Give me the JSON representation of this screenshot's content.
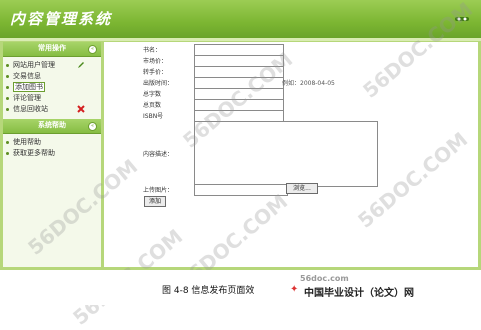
{
  "app": {
    "title": "内容管理系统"
  },
  "sidebar": {
    "panels": [
      {
        "title": "常用操作",
        "items": [
          {
            "label": "网站用户管理"
          },
          {
            "label": "交易信息"
          },
          {
            "label": "添加图书"
          },
          {
            "label": "评论管理"
          },
          {
            "label": "信息回收站"
          }
        ]
      },
      {
        "title": "系统帮助",
        "items": [
          {
            "label": "使用帮助"
          },
          {
            "label": "获取更多帮助"
          }
        ]
      }
    ]
  },
  "form": {
    "fields": {
      "book_name": {
        "label": "书名：",
        "value": ""
      },
      "market_price": {
        "label": "市场价：",
        "value": ""
      },
      "sale_price": {
        "label": "转手价：",
        "value": ""
      },
      "publish_date": {
        "label": "出版时间：",
        "value": "",
        "hint": "例如：2008-04-05"
      },
      "word_count": {
        "label": "总字数",
        "value": ""
      },
      "page_count": {
        "label": "总页数",
        "value": ""
      },
      "isbn": {
        "label": "ISBN号",
        "value": ""
      },
      "description": {
        "label": "内容描述：",
        "value": ""
      },
      "upload": {
        "label": "上传图片：",
        "value": "",
        "browse": "浏览..."
      }
    },
    "submit": "添加"
  },
  "watermarks": [
    "56DOC.COM",
    "56DOC.COM",
    "56DOC.COM",
    "56DOC.COM",
    "56DOC.COM",
    "56DOC.COM"
  ],
  "caption": {
    "text": "图 4-8  信息发布页面效",
    "site": "56doc.com",
    "brand": "中国毕业设计（论文）网"
  }
}
